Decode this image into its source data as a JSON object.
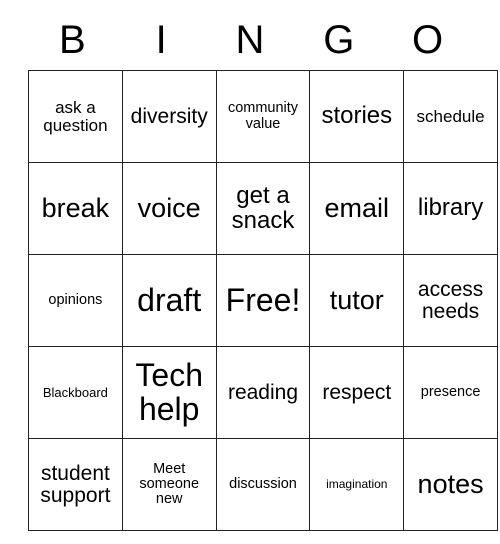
{
  "card": {
    "type": "bingo-card",
    "header_letters": [
      "B",
      "I",
      "N",
      "G",
      "O"
    ],
    "columns": 5,
    "rows": 5,
    "free_space_label": "Free!",
    "free_space_position": {
      "row": 3,
      "column": 3
    },
    "border_color": "#222222",
    "background_color": "#ffffff",
    "text_color": "#000000",
    "cells": [
      [
        {
          "text": "ask a question",
          "size": "s"
        },
        {
          "text": "diversity",
          "size": "m"
        },
        {
          "text": "community value",
          "size": "xs"
        },
        {
          "text": "stories",
          "size": "l"
        },
        {
          "text": "schedule",
          "size": "s"
        }
      ],
      [
        {
          "text": "break",
          "size": "xl"
        },
        {
          "text": "voice",
          "size": "xl"
        },
        {
          "text": "get a snack",
          "size": "l"
        },
        {
          "text": "email",
          "size": "xl"
        },
        {
          "text": "library",
          "size": "l"
        }
      ],
      [
        {
          "text": "opinions",
          "size": "xs"
        },
        {
          "text": "draft",
          "size": "xxl"
        },
        {
          "text": "Free!",
          "size": "xxl"
        },
        {
          "text": "tutor",
          "size": "xl"
        },
        {
          "text": "access needs",
          "size": "m"
        }
      ],
      [
        {
          "text": "Blackboard",
          "size": "xxs"
        },
        {
          "text": "Tech help",
          "size": "xxl"
        },
        {
          "text": "reading",
          "size": "m"
        },
        {
          "text": "respect",
          "size": "m"
        },
        {
          "text": "presence",
          "size": "xs"
        }
      ],
      [
        {
          "text": "student support",
          "size": "m"
        },
        {
          "text": "Meet someone new",
          "size": "xs"
        },
        {
          "text": "discussion",
          "size": "xs"
        },
        {
          "text": "imagination",
          "size": "tiny"
        },
        {
          "text": "notes",
          "size": "xl"
        }
      ]
    ]
  }
}
